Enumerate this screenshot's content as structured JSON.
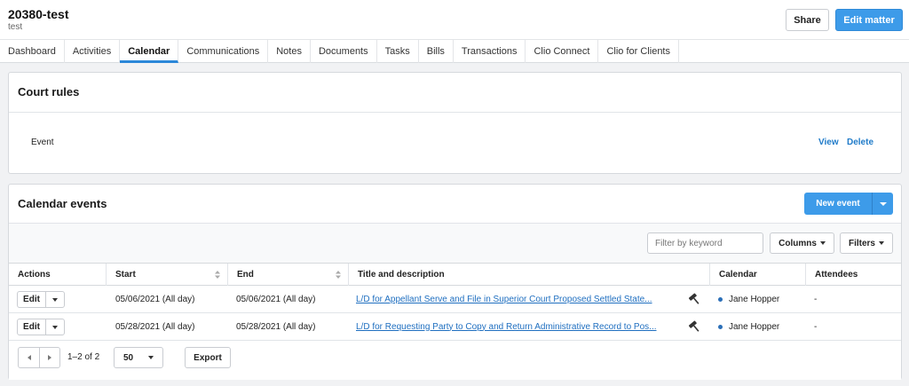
{
  "matter": {
    "title": "20380-test",
    "subtitle": "test"
  },
  "header_actions": {
    "share_label": "Share",
    "edit_label": "Edit matter"
  },
  "tabs": [
    {
      "label": "Dashboard"
    },
    {
      "label": "Activities"
    },
    {
      "label": "Calendar",
      "active": true
    },
    {
      "label": "Communications"
    },
    {
      "label": "Notes"
    },
    {
      "label": "Documents"
    },
    {
      "label": "Tasks"
    },
    {
      "label": "Bills"
    },
    {
      "label": "Transactions"
    },
    {
      "label": "Clio Connect"
    },
    {
      "label": "Clio for Clients"
    }
  ],
  "court_rules": {
    "title": "Court rules",
    "event_label": "Event",
    "view_label": "View",
    "delete_label": "Delete"
  },
  "calendar_events": {
    "title": "Calendar events",
    "new_event_label": "New event",
    "filter_placeholder": "Filter by keyword",
    "columns_label": "Columns",
    "filters_label": "Filters",
    "headers": {
      "actions": "Actions",
      "start": "Start",
      "end": "End",
      "title": "Title and description",
      "calendar": "Calendar",
      "attendees": "Attendees"
    },
    "rows": [
      {
        "action": "Edit",
        "start": "05/06/2021 (All day)",
        "end": "05/06/2021 (All day)",
        "title": "L/D for Appellant Serve and File in Superior Court Proposed Settled State...",
        "calendar": "Jane Hopper",
        "attendees": "-"
      },
      {
        "action": "Edit",
        "start": "05/28/2021 (All day)",
        "end": "05/28/2021 (All day)",
        "title": "L/D for Requesting Party to Copy and Return Administrative Record to Pos...",
        "calendar": "Jane Hopper",
        "attendees": "-"
      }
    ],
    "pagination": {
      "range": "1–2 of 2",
      "per_page": "50",
      "export_label": "Export"
    }
  },
  "colors": {
    "accent": "#3d9be9",
    "link": "#1f6fc0",
    "calendar_dot": "#2b6fb8"
  },
  "icons": {
    "row_icon": "gavel-icon",
    "sort_icon": "sort-icon"
  }
}
